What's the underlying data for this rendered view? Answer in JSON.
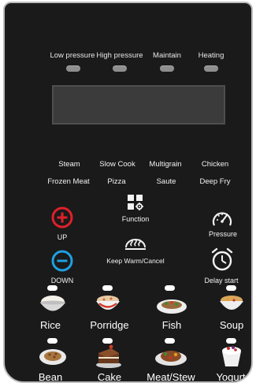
{
  "indicators": [
    {
      "label": "Low pressure"
    },
    {
      "label": "High pressure"
    },
    {
      "label": "Maintain"
    },
    {
      "label": "Heating"
    }
  ],
  "menu_row1": [
    "Steam",
    "Slow Cook",
    "Multigrain",
    "Chicken"
  ],
  "menu_row2": [
    "Frozen Meat",
    "Pizza",
    "Saute",
    "Deep Fry"
  ],
  "controls": {
    "up_label": "UP",
    "down_label": "DOWN",
    "function_label": "Function",
    "keep_warm_label": "Keep Warm/Cancel",
    "pressure_label": "Pressure",
    "delay_label": "Delay start"
  },
  "programs_row1": [
    "Rice",
    "Porridge",
    "Fish",
    "Soup"
  ],
  "programs_row2": [
    "Bean",
    "Cake",
    "Meat/Stew",
    "Yogurt"
  ],
  "colors": {
    "panel": "#1c1c1c",
    "up_button": "#e0202a",
    "down_button": "#1ea0e0",
    "led_indicator": "#8e8e8e",
    "led_program": "#ffffff"
  },
  "icons": {
    "up": "plus-circle-icon",
    "down": "minus-circle-icon",
    "function": "grid-gear-icon",
    "keep_warm": "steam-pot-icon",
    "pressure": "gauge-icon",
    "delay": "alarm-clock-icon"
  }
}
